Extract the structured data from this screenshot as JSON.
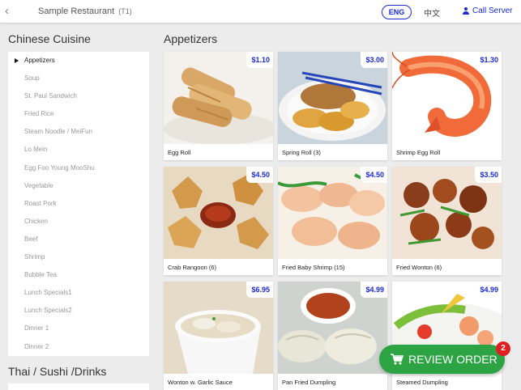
{
  "header": {
    "back_icon": "chevron-left-icon",
    "restaurant": "Sample Restaurant",
    "table": "(T1)",
    "lang_eng": "ENG",
    "lang_zh": "中文",
    "call_server": "Call Server"
  },
  "sections": {
    "chinese": "Chinese Cuisine",
    "thai": "Thai / Sushi /Drinks",
    "current": "Appetizers"
  },
  "sidebar": {
    "items": [
      {
        "label": "Appetizers",
        "active": true
      },
      {
        "label": "Soup"
      },
      {
        "label": "St. Paul Sandwich"
      },
      {
        "label": "Fried Rice"
      },
      {
        "label": "Steam Noodle / MeiFun"
      },
      {
        "label": "Lo Mein"
      },
      {
        "label": "Egg Foo Young MooShu"
      },
      {
        "label": "Vegetable"
      },
      {
        "label": "Roast Pork"
      },
      {
        "label": "Chicken"
      },
      {
        "label": "Beef"
      },
      {
        "label": "Shrimp"
      },
      {
        "label": "Bubble Tea"
      },
      {
        "label": "Lunch Specials1"
      },
      {
        "label": "Lunch Specials2"
      },
      {
        "label": "Dinner 1"
      },
      {
        "label": "Dinner 2"
      }
    ]
  },
  "items": [
    {
      "name": "Egg Roll",
      "price": "$1.10",
      "image": "egg-roll-photo"
    },
    {
      "name": "Spring Roll (3)",
      "price": "$3.00",
      "image": "spring-roll-photo"
    },
    {
      "name": "Shrimp Egg Roll",
      "price": "$1.30",
      "image": "shrimp-photo"
    },
    {
      "name": "Crab Rangoon (6)",
      "price": "$4.50",
      "image": "crab-rangoon-photo"
    },
    {
      "name": "Fried Baby Shrimp (15)",
      "price": "$4.50",
      "image": "fried-shrimp-photo"
    },
    {
      "name": "Fried Wonton (6)",
      "price": "$3.50",
      "image": "fried-wonton-photo"
    },
    {
      "name": "Wonton w. Garlic Sauce",
      "price": "$6.95",
      "image": "wonton-soup-photo"
    },
    {
      "name": "Pan Fried Dumpling",
      "price": "$4.99",
      "image": "dumpling-photo"
    },
    {
      "name": "Steamed Dumpling",
      "price": "$4.99",
      "image": "steamed-dumpling-photo"
    }
  ],
  "review": {
    "label": "REVIEW ORDER",
    "count": "2",
    "icon": "cart-icon"
  },
  "colors": {
    "accent": "#1a2ad0",
    "review_green": "#2da444",
    "badge_red": "#e02020"
  }
}
